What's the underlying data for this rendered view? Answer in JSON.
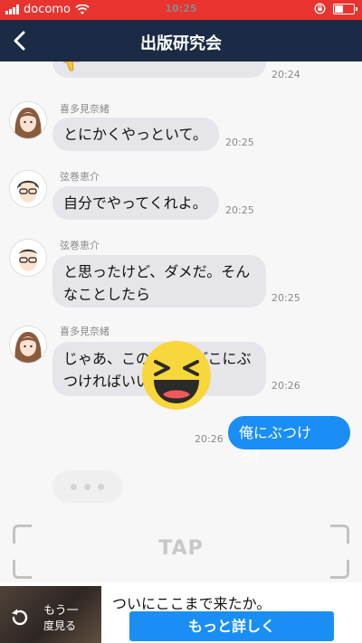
{
  "status_bar": {
    "carrier": "docomo",
    "time": "10:25"
  },
  "header": {
    "title": "出版研究会"
  },
  "messages": [
    {
      "time": "20:24"
    },
    {
      "sender": "喜多見奈緒",
      "text": "とにかくやっといて。",
      "time": "20:25"
    },
    {
      "sender": "弦巻恵介",
      "text": "自分でやってくれよ。",
      "time": "20:25"
    },
    {
      "sender": "弦巻恵介",
      "line1": "と思ったけど、ダメだ。そん",
      "line2": "なことしたら",
      "time": "20:25"
    },
    {
      "sender": "喜多見奈緒",
      "line1": "じゃあ、この怒りをどこにぶ",
      "line2": "つければいいわけ？",
      "time": "20:26"
    },
    {
      "text": "俺にぶつけろ！",
      "time": "20:26"
    }
  ],
  "tap_prompt": "TAP",
  "footer": {
    "replay_line1": "もう一",
    "replay_line2": "度見る",
    "text": "ついにここまで来たか。",
    "more_button": "もっと詳しく"
  },
  "icons": [
    "signal-icon",
    "wifi-icon",
    "lock-rotation-icon",
    "battery-icon",
    "back-chevron-icon",
    "thumbs-down-emoji-icon",
    "laughing-emoji-icon",
    "replay-icon"
  ]
}
